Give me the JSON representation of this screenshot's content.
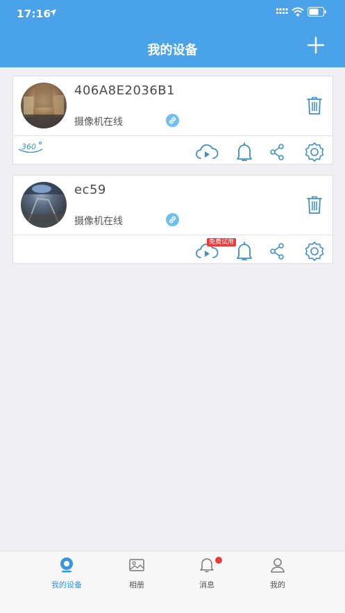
{
  "status_bar": {
    "time": "17:16"
  },
  "header": {
    "title": "我的设备"
  },
  "devices": [
    {
      "name": "406A8E2036B1",
      "status": "摄像机在线",
      "has_360": true,
      "trial_badge": ""
    },
    {
      "name": "ec59",
      "status": "摄像机在线",
      "has_360": false,
      "trial_badge": "免费试用"
    }
  ],
  "tabs": [
    {
      "label": "我的设备",
      "icon": "camera-icon",
      "active": true
    },
    {
      "label": "相册",
      "icon": "photo-icon",
      "active": false
    },
    {
      "label": "消息",
      "icon": "bell-icon",
      "active": false,
      "has_dot": true
    },
    {
      "label": "我的",
      "icon": "person-icon",
      "active": false
    }
  ],
  "colors": {
    "accent": "#4aa3e8",
    "icon_blue": "#3e8fc7",
    "badge_red": "#e83b3b",
    "link_blue": "#6fc0ef"
  }
}
